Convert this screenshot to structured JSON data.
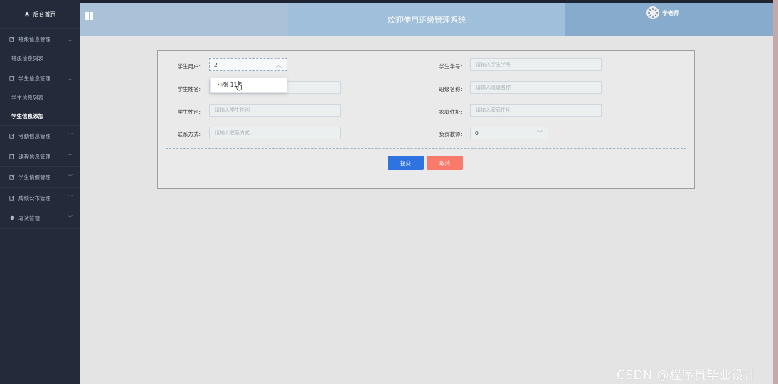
{
  "sidebar": {
    "home_label": "后台首页",
    "groups": [
      {
        "label": "班级信息管理",
        "items": [
          "班级信息列表"
        ]
      },
      {
        "label": "学生信息管理",
        "items": [
          "学生信息列表",
          "学生信息添加"
        ]
      },
      {
        "label": "考勤信息管理",
        "items": []
      },
      {
        "label": "课程信息管理",
        "items": []
      },
      {
        "label": "学生请假管理",
        "items": []
      },
      {
        "label": "成绩公布管理",
        "items": []
      },
      {
        "label": "考试管理",
        "items": []
      }
    ],
    "active_item": "学生信息添加"
  },
  "header": {
    "title": "欢迎使用班级管理系统",
    "user_name": "李老师"
  },
  "form": {
    "student_user": {
      "label": "学生用户:",
      "value": "2"
    },
    "student_no": {
      "label": "学生学号:",
      "placeholder": "请输入学生学号"
    },
    "student_name": {
      "label": "学生姓名:",
      "placeholder": "请输入学生姓名"
    },
    "class_name": {
      "label": "班级名称:",
      "placeholder": "请输入班级名称"
    },
    "student_gender": {
      "label": "学生性别:",
      "placeholder": "请输入学生性别"
    },
    "home_address": {
      "label": "家庭住址:",
      "placeholder": "请输入家庭住址"
    },
    "contact": {
      "label": "联系方式:",
      "placeholder": "请输入联系方式"
    },
    "teacher": {
      "label": "负责教师:",
      "value": "0"
    },
    "submit_label": "提交",
    "cancel_label": "取消"
  },
  "dropdown": {
    "option": "小张-11号"
  },
  "watermark": "CSDN @程序员毕业设计",
  "colors": {
    "sidebar": "#232b3a",
    "header": "#a9c2d8",
    "submit": "#2f73e0",
    "cancel": "#f97a6b"
  }
}
